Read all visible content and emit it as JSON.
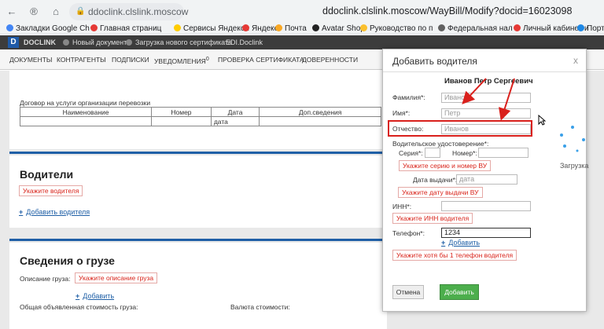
{
  "browser": {
    "domain": "ddoclink.clslink.moscow",
    "title": "ddoclink.clslink.moscow/WayBill/Modify?docid=16023098",
    "bookmarks": [
      {
        "label": "Закладки Google Ch",
        "color": "#4285f4"
      },
      {
        "label": "Главная страниц",
        "color": "#e53935"
      },
      {
        "label": "Сервисы Яндекса",
        "color": "#ffcc00"
      },
      {
        "label": "Яндекс",
        "color": "#e53935"
      },
      {
        "label": "Почта",
        "color": "#f9a825"
      },
      {
        "label": "Avatar Shop",
        "color": "#222222"
      },
      {
        "label": "Руководство по п",
        "color": "#fbc02d"
      },
      {
        "label": "Федеральная нал",
        "color": "#616161"
      },
      {
        "label": "Личный кабинет и",
        "color": "#e53935"
      },
      {
        "label": "Портал",
        "color": "#1e88e5"
      }
    ]
  },
  "app": {
    "logo": "D",
    "brand": "DOCLINK",
    "header_items": [
      "Новый документ",
      "Загрузка нового сертификата",
      "EDI.Doclink"
    ],
    "menu": {
      "documents": "Документы",
      "counterparties": "Контрагенты",
      "signatures": "Подписки",
      "notifications": "Уведомления",
      "notifications_count": "0",
      "cert_check": "Проверка сертификата",
      "power": "Доверенности"
    }
  },
  "page": {
    "contract_text": "Договор на услуги организации перевозки",
    "table_headers": [
      "Наименование",
      "Номер",
      "Дата",
      "Доп.сведения"
    ],
    "table_row": [
      "",
      "",
      "дата",
      ""
    ],
    "drivers": {
      "title": "Водители",
      "error": "Укажите водителя",
      "add_link": "Добавить водителя"
    },
    "cargo": {
      "title": "Сведения о грузе",
      "desc_label": "Описание груза:",
      "desc_error": "Укажите описание груза",
      "add_link": "Добавить",
      "total_value_label": "Общая объявленная стоимость груза:",
      "currency_label": "Валюта стоимости:"
    }
  },
  "modal": {
    "title": "Добавить водителя",
    "close": "x",
    "driver_name": "Иванов Петр Сергеевич",
    "surname_label": "Фамилия*:",
    "surname_placeholder": "Иванов",
    "name_label": "Имя*:",
    "name_placeholder": "Петр",
    "patronymic_label": "Отчество:",
    "patronymic_placeholder": "Иванов",
    "license_label": "Водительское удостоверение*:",
    "series_label": "Серия*:",
    "number_label": "Номер*:",
    "license_error": "Укажите серию и номер ВУ",
    "issue_date_label": "Дата выдачи*:",
    "issue_date_placeholder": "дата",
    "issue_date_error": "Укажите дату выдачи ВУ",
    "inn_label": "ИНН*:",
    "inn_error": "Укажите ИНН водителя",
    "phone_label": "Телефон*:",
    "phone_value": "1234",
    "phone_add": "Добавить",
    "phone_error": "Укажите хотя бы 1 телефон водителя",
    "cancel_button": "Отмена",
    "add_button": "Добавить"
  },
  "loading_text": "Загрузка"
}
